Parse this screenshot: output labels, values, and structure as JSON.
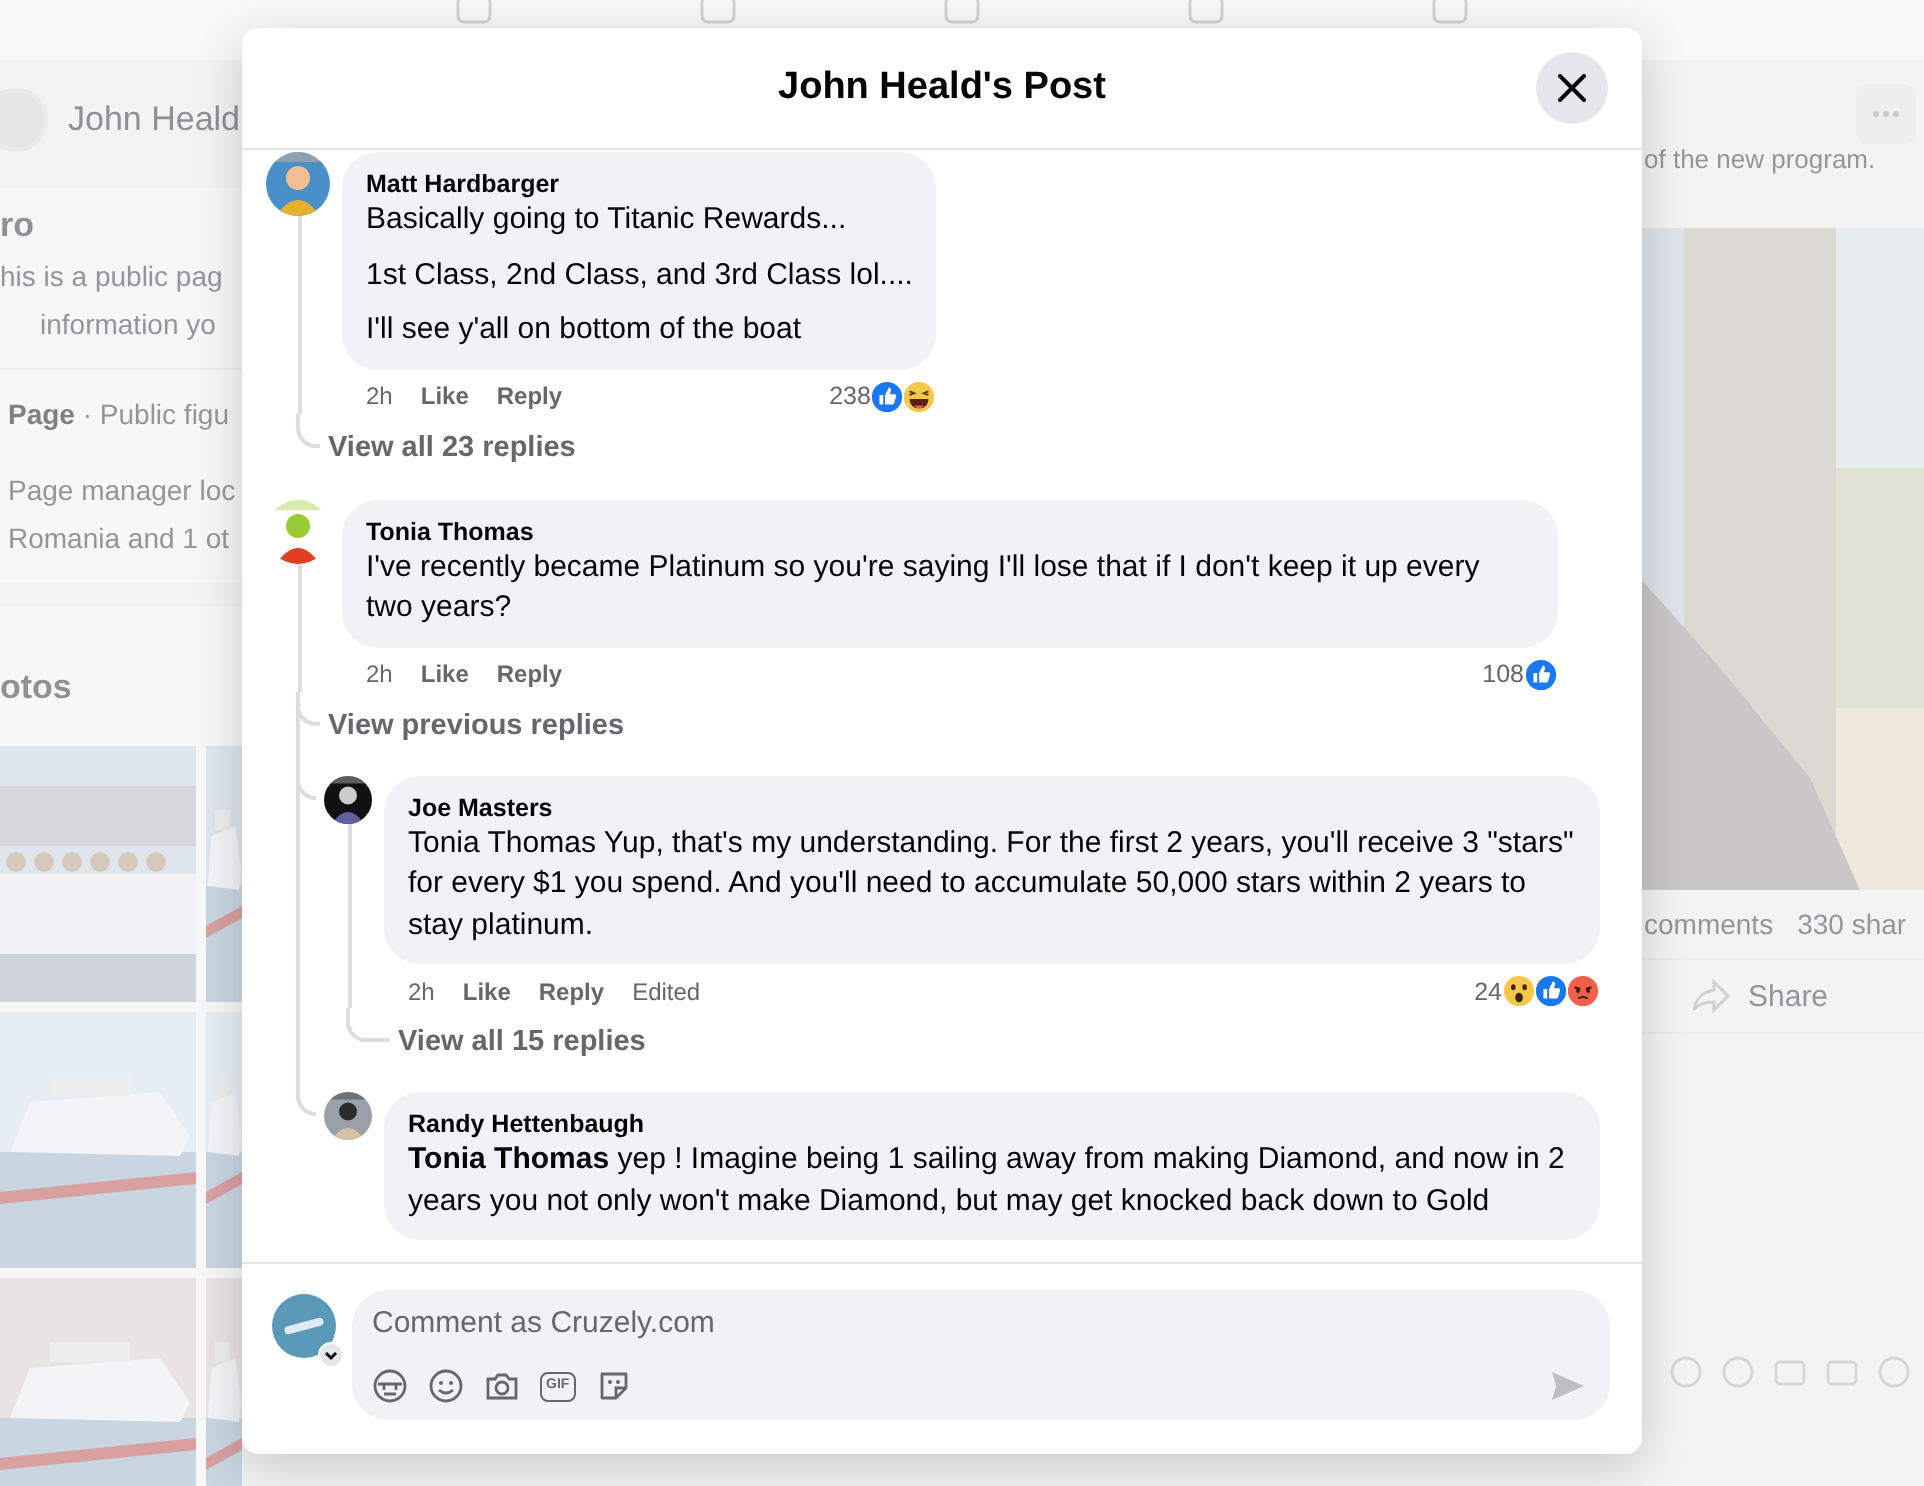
{
  "background": {
    "profile": {
      "name": "John Heald"
    },
    "intro": {
      "heading": "ro",
      "description": [
        "his is a public pag",
        "information yo"
      ],
      "details": [
        "**Page** · Public figu",
        "Page manager loc",
        "Romania and 1 ot"
      ]
    },
    "photos": {
      "heading": "otos"
    },
    "post": {
      "snippet": "of the new program.",
      "comments": "comments",
      "shares": "330 shar",
      "share_label": "Share"
    }
  },
  "modal": {
    "title": "John Heald's Post",
    "comments": [
      {
        "author": "Matt Hardbarger",
        "paragraphs": [
          "Basically going to Titanic Rewards...",
          "1st Class, 2nd Class, and 3rd Class lol....",
          "I'll see y'all on bottom of the boat"
        ],
        "time": "2h",
        "actions": [
          "Like",
          "Reply"
        ],
        "reaction_count": "238",
        "reactions": [
          {
            "kind": "like"
          },
          {
            "kind": "haha"
          }
        ],
        "more_replies": "View all 23 replies"
      },
      {
        "author": "Tonia Thomas",
        "paragraphs": [
          "I've recently became Platinum so you're saying I'll lose that if I don't keep it up every two years?"
        ],
        "time": "2h",
        "actions": [
          "Like",
          "Reply"
        ],
        "reaction_count": "108",
        "reactions": [
          {
            "kind": "like"
          }
        ],
        "previous_replies": "View previous replies",
        "children": [
          {
            "author": "Joe Masters",
            "paragraphs": [
              "Tonia Thomas Yup, that's my understanding. For the first 2 years, you'll receive 3 \"stars\" for every $1 you spend. And you'll need to accumulate 50,000 stars within 2 years to stay platinum."
            ],
            "time": "2h",
            "actions": [
              "Like",
              "Reply"
            ],
            "edited": "Edited",
            "reaction_count": "24",
            "reactions": [
              {
                "kind": "wow"
              },
              {
                "kind": "like"
              },
              {
                "kind": "angry"
              }
            ],
            "more_replies": "View all 15 replies"
          },
          {
            "author": "Randy Hettenbaugh",
            "paragraphs": [
              "**Tonia Thomas** yep ! Imagine being 1 sailing away from making Diamond, and now in 2 years you not only won't make Diamond, but may get knocked back down to Gold"
            ]
          }
        ]
      }
    ],
    "composer": {
      "placeholder": "Comment as Cruzely.com",
      "gif_label": "GIF"
    }
  }
}
